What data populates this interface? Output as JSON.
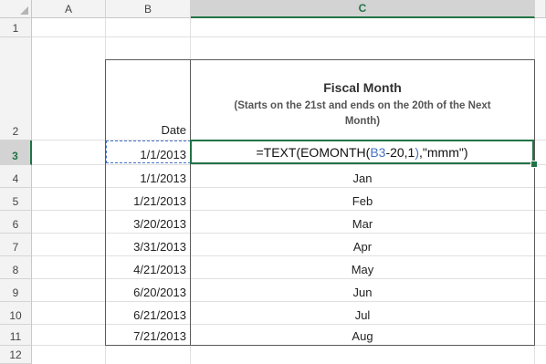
{
  "columns": [
    "A",
    "B",
    "C"
  ],
  "rows": [
    "1",
    "2",
    "3",
    "4",
    "5",
    "6",
    "7",
    "8",
    "9",
    "10",
    "11",
    "12"
  ],
  "header": {
    "date_label": "Date",
    "fiscal_title": "Fiscal Month",
    "fiscal_sub_1": "(Starts on the 21st and ends on the 20th of the Next",
    "fiscal_sub_2": "Month)"
  },
  "formula": {
    "prefix": "=TEXT(EOMONTH(",
    "ref": "B3",
    "middle": "-20,1",
    "close_paren": ")",
    "suffix": ",\"mmm\")"
  },
  "dates": [
    "1/1/2013",
    "1/1/2013",
    "1/21/2013",
    "3/20/2013",
    "3/31/2013",
    "4/21/2013",
    "6/20/2013",
    "6/21/2013",
    "7/21/2013"
  ],
  "months": [
    "Jan",
    "Feb",
    "Mar",
    "Apr",
    "May",
    "Jun",
    "Jul",
    "Aug"
  ],
  "colors": {
    "accent": "#217346",
    "reference": "#4472c4"
  }
}
